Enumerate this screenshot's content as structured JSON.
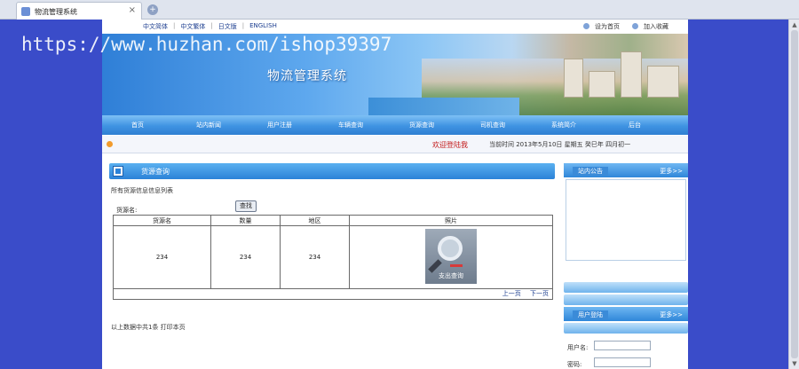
{
  "browser": {
    "tab_title": "物流管理系统",
    "close_glyph": "×",
    "new_tab_glyph": "+"
  },
  "header": {
    "languages": [
      "中文简体",
      "中文繁体",
      "日文版",
      "ENGLISH"
    ],
    "set_home": "设为首页",
    "add_favorite": "加入收藏",
    "site_name": "物流管理系统"
  },
  "nav": {
    "items": [
      "首页",
      "站内新闻",
      "用户注册",
      "车辆查询",
      "货源查询",
      "司机查询",
      "系统简介",
      "后台"
    ]
  },
  "infobar": {
    "welcome": "欢迎登陆我",
    "time": "当前时间  2013年5月10日 星期五 癸巳年 四月初一"
  },
  "main": {
    "panel_title": "货源查询",
    "list_title": "所有货源信息信息列表",
    "search_label": "货源名:",
    "search_button": "查找",
    "columns": [
      "货源名",
      "数量",
      "地区",
      "照片"
    ],
    "rows": [
      {
        "name": "234",
        "qty": "234",
        "region": "234",
        "photo_caption": "支出查询"
      }
    ],
    "pager_prev": "上一页",
    "pager_next": "下一页",
    "footer": "以上数据中共1条  打印本页"
  },
  "sidebar": {
    "notice_title": "站内公告",
    "more": "更多>>",
    "login_title": "用户登陆",
    "login_more": "更多>>",
    "username_label": "用户名:",
    "password_label": "密码:"
  },
  "watermark": "https://www.huzhan.com/ishop39397",
  "colors": {
    "page_bg": "#3a4cc9",
    "nav_blue": "#3f93e2",
    "welcome_red": "#c21818"
  }
}
